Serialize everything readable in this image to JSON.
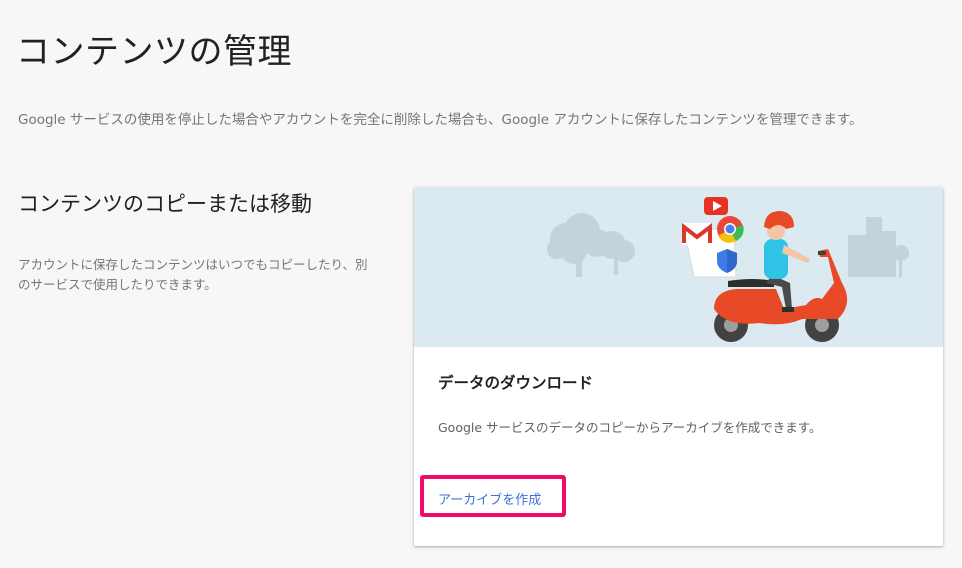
{
  "page": {
    "title": "コンテンツの管理",
    "description": "Google サービスの使用を停止した場合やアカウントを完全に削除した場合も、Google アカウントに保存したコンテンツを管理できます。"
  },
  "section": {
    "title": "コンテンツのコピーまたは移動",
    "description": "アカウントに保存したコンテンツはいつでもコピーしたり、別のサービスで使用したりできます。"
  },
  "card": {
    "illustration": "scooter-delivery-illustration",
    "title": "データのダウンロード",
    "description": "Google サービスのデータのコピーからアーカイブを作成できます。",
    "action_label": "アーカイブを作成"
  },
  "colors": {
    "background": "#f7f7f7",
    "card_header_bg": "#dbe9f0",
    "link": "#3e6fd6",
    "highlight_border": "#ee0c6b",
    "scooter": "#e84a27"
  }
}
